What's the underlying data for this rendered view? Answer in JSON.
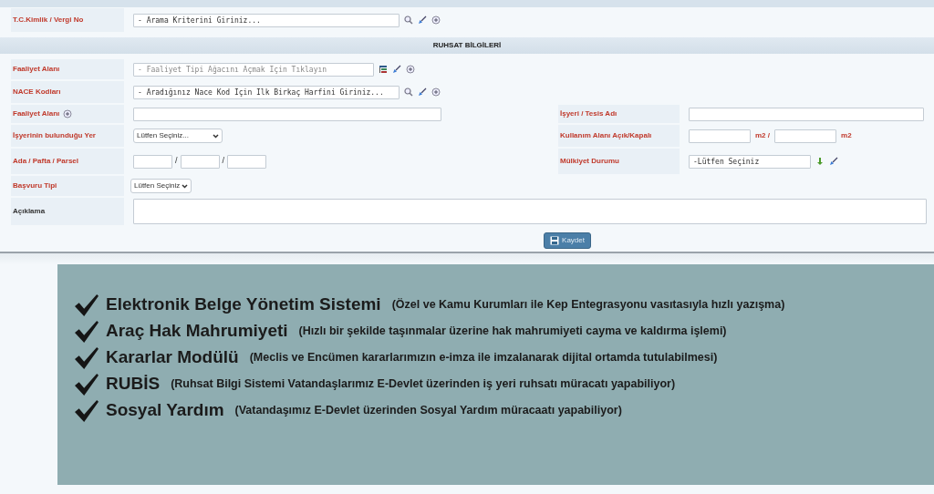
{
  "search_row": {
    "label": "T.C.Kimlik / Vergi No",
    "required": true,
    "kind": "search-lookup",
    "placeholder": "- Arama Kriterini Giriniz..."
  },
  "section_title": "RUHSAT BİLGİLERİ",
  "rows": [
    {
      "left": {
        "label": "Faaliyet Alanı",
        "required": true,
        "kind": "tree-lookup",
        "placeholder": "- Faaliyet Tipi Ağacını Açmak İçin Tıklayın"
      }
    },
    {
      "left": {
        "label": "NACE Kodları",
        "required": true,
        "kind": "search-lookup",
        "placeholder": "- Aradığınız Nace Kod İçin İlk Birkaç Harfini Giriniz..."
      }
    },
    {
      "left": {
        "label": "Faaliyet Alanı",
        "required": true,
        "kind": "text",
        "info": true
      },
      "right": {
        "label": "İşyeri / Tesis Adı",
        "required": true,
        "kind": "wide-text"
      }
    },
    {
      "left": {
        "label": "İşyerinin bulunduğu Yer",
        "required": true,
        "kind": "select",
        "value": "Lütfen Seçiniz..."
      },
      "right": {
        "label": "Kullanım Alanı Açık/Kapalı",
        "required": true,
        "kind": "area",
        "units": [
          "m2 /",
          "m2"
        ]
      }
    },
    {
      "left": {
        "label": "Ada / Pafta / Parsel",
        "required": true,
        "kind": "triple",
        "separators": [
          "/",
          "/"
        ]
      },
      "right": {
        "label": "Mülkiyet Durumu",
        "required": true,
        "kind": "picker",
        "value": "-Lütfen Seçiniz"
      }
    },
    {
      "left": {
        "label": "Başvuru Tipi",
        "required": true,
        "kind": "small-select",
        "value": "Lütfen Seçiniz"
      }
    },
    {
      "left": {
        "label": "Açıklama",
        "required": false,
        "kind": "textarea"
      }
    }
  ],
  "save_button": "Kaydet",
  "features": [
    {
      "title": "Elektronik Belge Yönetim Sistemi",
      "detail": "(Özel ve Kamu Kurumları ile Kep Entegrasyonu vasıtasıyla hızlı yazışma)"
    },
    {
      "title": "Araç Hak Mahrumiyeti",
      "detail": "(Hızlı bir şekilde taşınmalar üzerine hak mahrumiyeti cayma ve kaldırma işlemi)"
    },
    {
      "title": "Kararlar Modülü",
      "detail": "(Meclis ve Encümen kararlarımızın e-imza ile imzalanarak dijital ortamda tutulabilmesi)"
    },
    {
      "title": "RUBİS",
      "detail": "(Ruhsat Bilgi Sistemi Vatandaşlarımız E-Devlet üzerinden iş yeri ruhsatı müracatı yapabiliyor)"
    },
    {
      "title": "Sosyal Yardım",
      "detail": "(Vatandaşımız E-Devlet üzerinden Sosyal Yardım müracaatı yapabiliyor)"
    }
  ]
}
